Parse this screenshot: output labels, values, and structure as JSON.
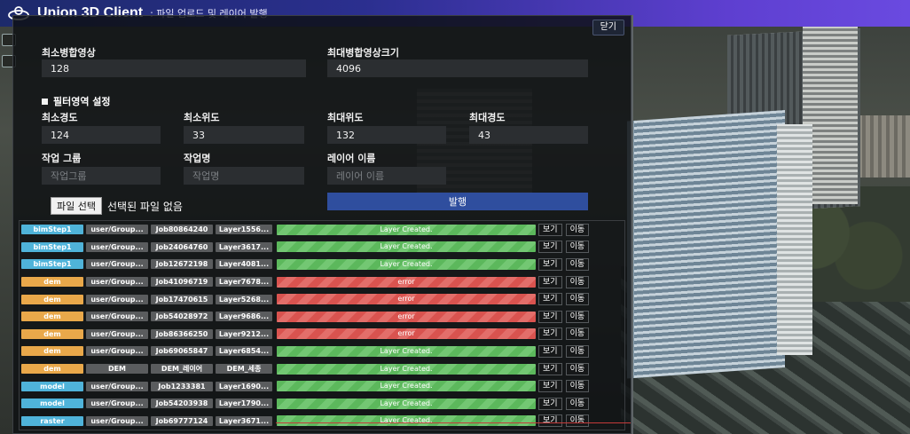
{
  "header": {
    "title": "Union 3D Client",
    "subtitle": ": 파일 업로드 및 레이어 발행"
  },
  "panel": {
    "close_label": "닫기",
    "fields": {
      "min_merge": {
        "label": "최소병합영상",
        "value": "128"
      },
      "max_merge": {
        "label": "최대병합영상크기",
        "value": "4096"
      },
      "min_lon": {
        "label": "최소경도",
        "value": "124"
      },
      "min_lat": {
        "label": "최소위도",
        "value": "33"
      },
      "max_lat": {
        "label": "최대위도",
        "value": "132"
      },
      "max_lon": {
        "label": "최대경도",
        "value": "43"
      },
      "work_group": {
        "label": "작업 그룹",
        "placeholder": "작업그룹"
      },
      "work_name": {
        "label": "작업명",
        "placeholder": "작업명"
      },
      "layer_name": {
        "label": "레이어 이름",
        "placeholder": "레이어 이름"
      }
    },
    "filter_label": "필터영역 설정",
    "file_button": "파일 선택",
    "file_status": "선택된 파일 없음",
    "publish_label": "발행"
  },
  "colors": {
    "bimStep1": "#4fb3d9",
    "dem": "#e9a84a",
    "model": "#4fb3d9",
    "raster": "#4fb3d9"
  },
  "jobs": [
    {
      "type": "bimStep1",
      "user": "user/Group...",
      "job": "Job80864240",
      "layer": "Layer1556...",
      "status": "Layer Created.",
      "state": "ok",
      "view": "보기",
      "move": "이동"
    },
    {
      "type": "bimStep1",
      "user": "user/Group...",
      "job": "Job24064760",
      "layer": "Layer3617...",
      "status": "Layer Created.",
      "state": "ok",
      "view": "보기",
      "move": "이동"
    },
    {
      "type": "bimStep1",
      "user": "user/Group...",
      "job": "Job12672198",
      "layer": "Layer4081...",
      "status": "Layer Created.",
      "state": "ok",
      "view": "보기",
      "move": "이동"
    },
    {
      "type": "dem",
      "user": "user/Group...",
      "job": "Job41096719",
      "layer": "Layer7678...",
      "status": "error",
      "state": "err",
      "view": "보기",
      "move": "이동"
    },
    {
      "type": "dem",
      "user": "user/Group...",
      "job": "Job17470615",
      "layer": "Layer5268...",
      "status": "error",
      "state": "err",
      "view": "보기",
      "move": "이동"
    },
    {
      "type": "dem",
      "user": "user/Group...",
      "job": "Job54028972",
      "layer": "Layer9686...",
      "status": "error",
      "state": "err",
      "view": "보기",
      "move": "이동"
    },
    {
      "type": "dem",
      "user": "user/Group...",
      "job": "Job86366250",
      "layer": "Layer9212...",
      "status": "error",
      "state": "err",
      "view": "보기",
      "move": "이동"
    },
    {
      "type": "dem",
      "user": "user/Group...",
      "job": "Job69065847",
      "layer": "Layer6854...",
      "status": "Layer Created.",
      "state": "ok",
      "view": "보기",
      "move": "이동"
    },
    {
      "type": "dem",
      "user": "DEM",
      "job": "DEM_레이어",
      "layer": "DEM_세종",
      "status": "Layer Created.",
      "state": "ok",
      "view": "보기",
      "move": "이동"
    },
    {
      "type": "model",
      "user": "user/Group...",
      "job": "Job1233381",
      "layer": "Layer1690...",
      "status": "Layer Created.",
      "state": "ok",
      "view": "보기",
      "move": "이동"
    },
    {
      "type": "model",
      "user": "user/Group...",
      "job": "Job54203938",
      "layer": "Layer1790...",
      "status": "Layer Created.",
      "state": "ok",
      "view": "보기",
      "move": "이동"
    },
    {
      "type": "raster",
      "user": "user/Group...",
      "job": "Job69777124",
      "layer": "Layer3671...",
      "status": "Layer Created.",
      "state": "ok",
      "view": "보기",
      "move": "이동"
    }
  ]
}
